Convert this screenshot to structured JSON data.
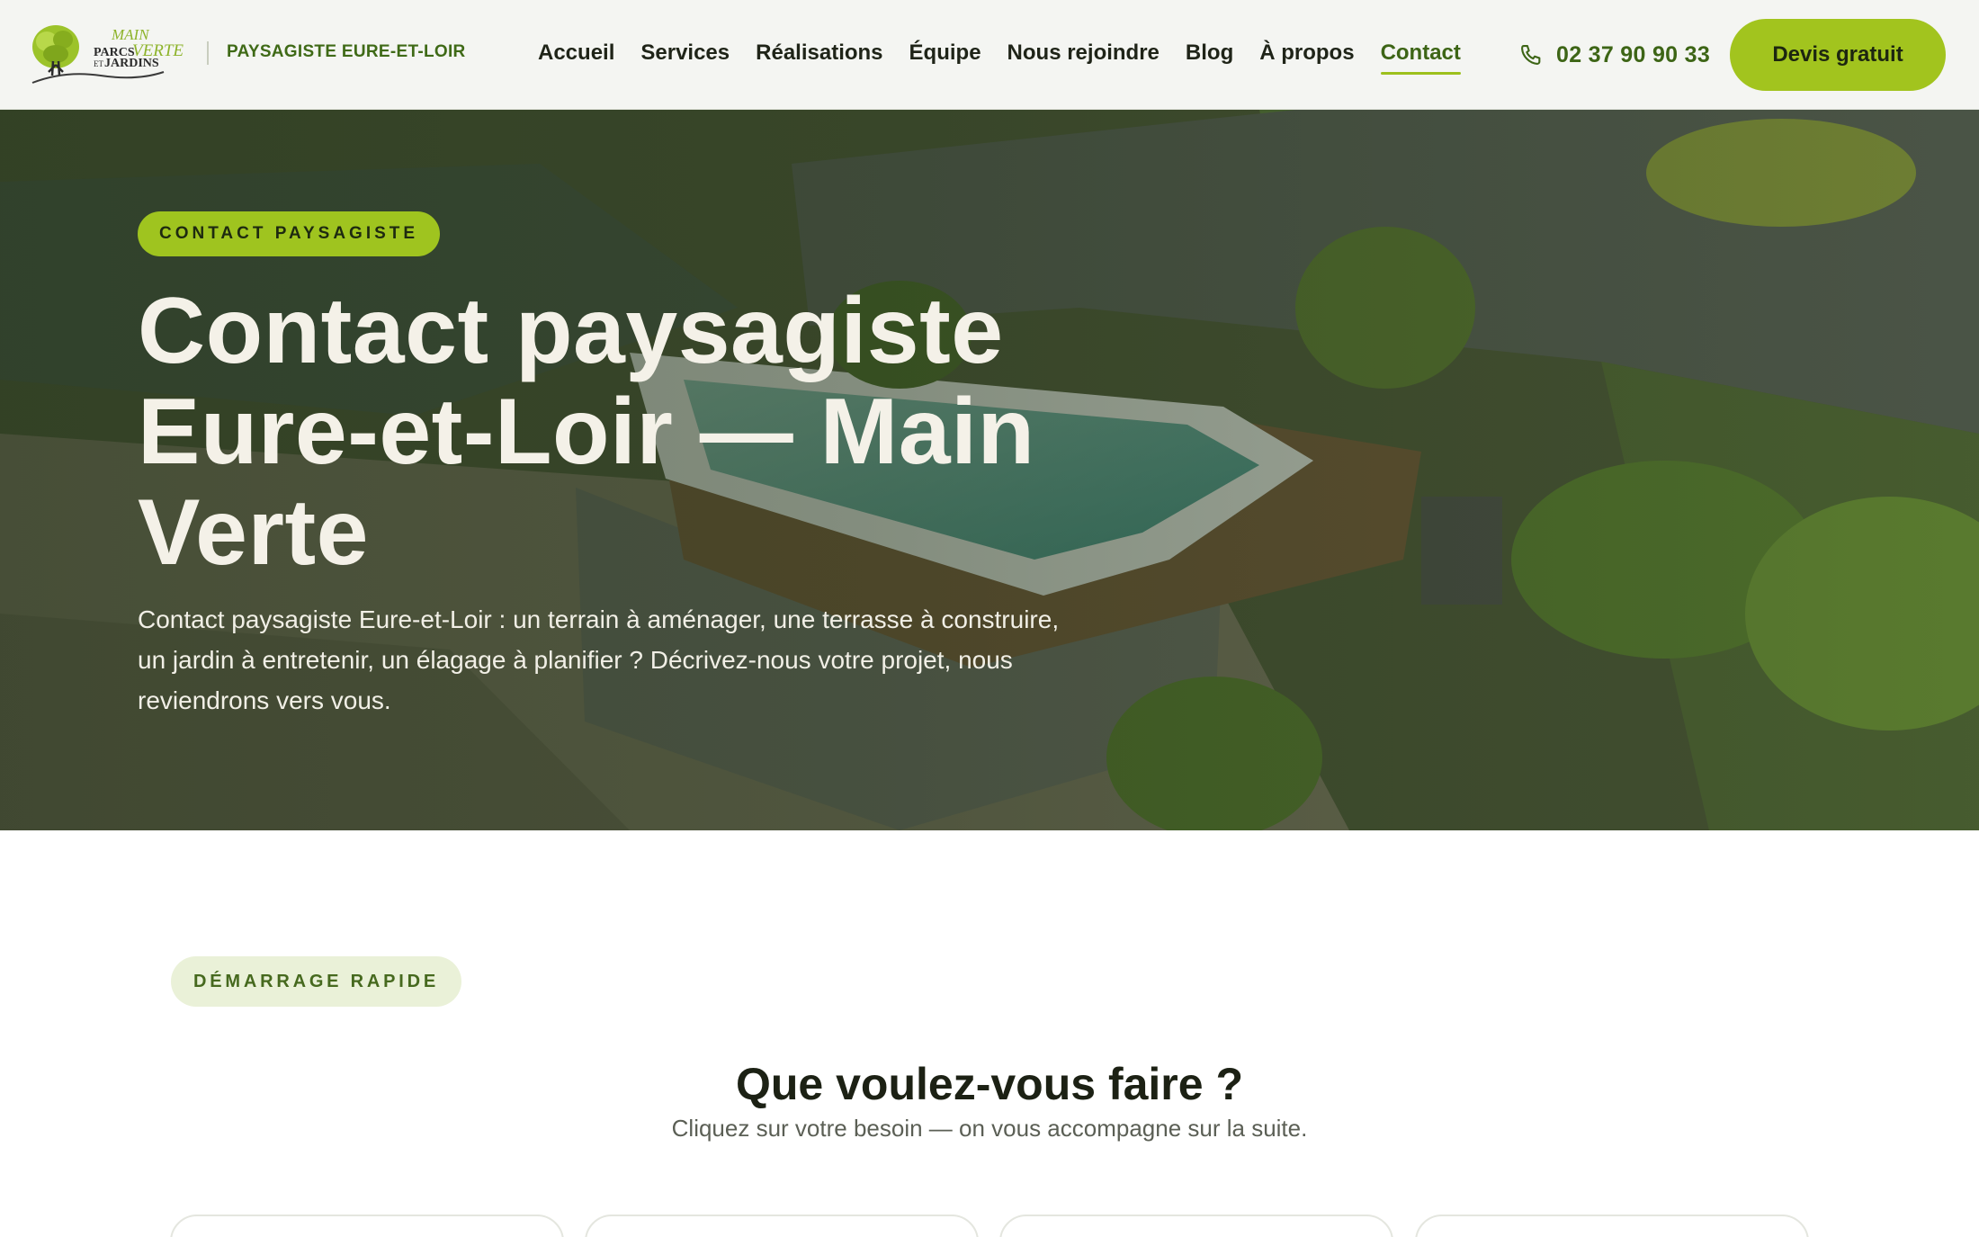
{
  "header": {
    "logo": {
      "line1": "MAIN",
      "line2a": "PARCS",
      "line2b": "VERTE",
      "line3a": "ET",
      "line3b": "JARDINS"
    },
    "tagline": "PAYSAGISTE EURE-ET-LOIR",
    "nav": [
      {
        "label": "Accueil",
        "active": false
      },
      {
        "label": "Services",
        "active": false
      },
      {
        "label": "Réalisations",
        "active": false
      },
      {
        "label": "Équipe",
        "active": false
      },
      {
        "label": "Nous rejoindre",
        "active": false
      },
      {
        "label": "Blog",
        "active": false
      },
      {
        "label": "À propos",
        "active": false
      },
      {
        "label": "Contact",
        "active": true
      }
    ],
    "phone": "02 37 90 90 33",
    "cta": "Devis gratuit"
  },
  "hero": {
    "badge": "CONTACT PAYSAGISTE",
    "title": "Contact paysagiste Eure-et-Loir — Main Verte",
    "subtitle": "Contact paysagiste Eure-et-Loir : un terrain à aménager, une terrasse à construire, un jardin à entretenir, un élagage à planifier ? Décrivez-nous votre projet, nous reviendrons vers vous."
  },
  "quickstart": {
    "badge": "DÉMARRAGE RAPIDE",
    "title": "Que voulez-vous faire ?",
    "subtitle": "Cliquez sur votre besoin — on vous accompagne sur la suite."
  },
  "colors": {
    "accent": "#a2c41e",
    "accent_dark": "#3d6516",
    "header_bg": "#f4f5f2",
    "text_dark": "#1f2418"
  },
  "icons": {
    "phone": "phone-icon",
    "logo": "tree-logo-icon"
  }
}
